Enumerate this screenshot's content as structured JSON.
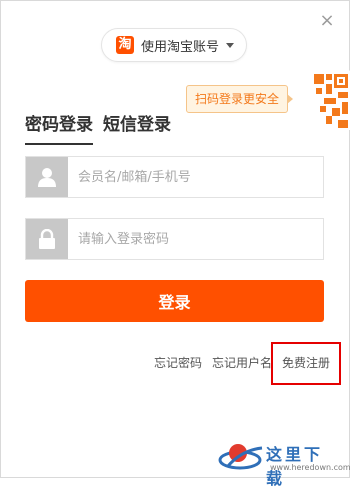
{
  "header": {
    "account_switch_label": "使用淘宝账号",
    "logo_char": "淘",
    "close_symbol": "×"
  },
  "qr": {
    "tip": "扫码登录更安全",
    "accent": "#f3791b"
  },
  "tabs": [
    {
      "label": "密码登录",
      "active": true
    },
    {
      "label": "短信登录",
      "active": false
    }
  ],
  "form": {
    "username_placeholder": "会员名/邮箱/手机号",
    "password_placeholder": "请输入登录密码",
    "login_label": "登录"
  },
  "links": {
    "forgot_password": "忘记密码",
    "forgot_username": "忘记用户名",
    "register": "免费注册"
  },
  "watermark": {
    "text": "这里下载",
    "url": "www.heredown.com"
  },
  "colors": {
    "brand": "#ff5000",
    "highlight_box": "#e50000"
  }
}
